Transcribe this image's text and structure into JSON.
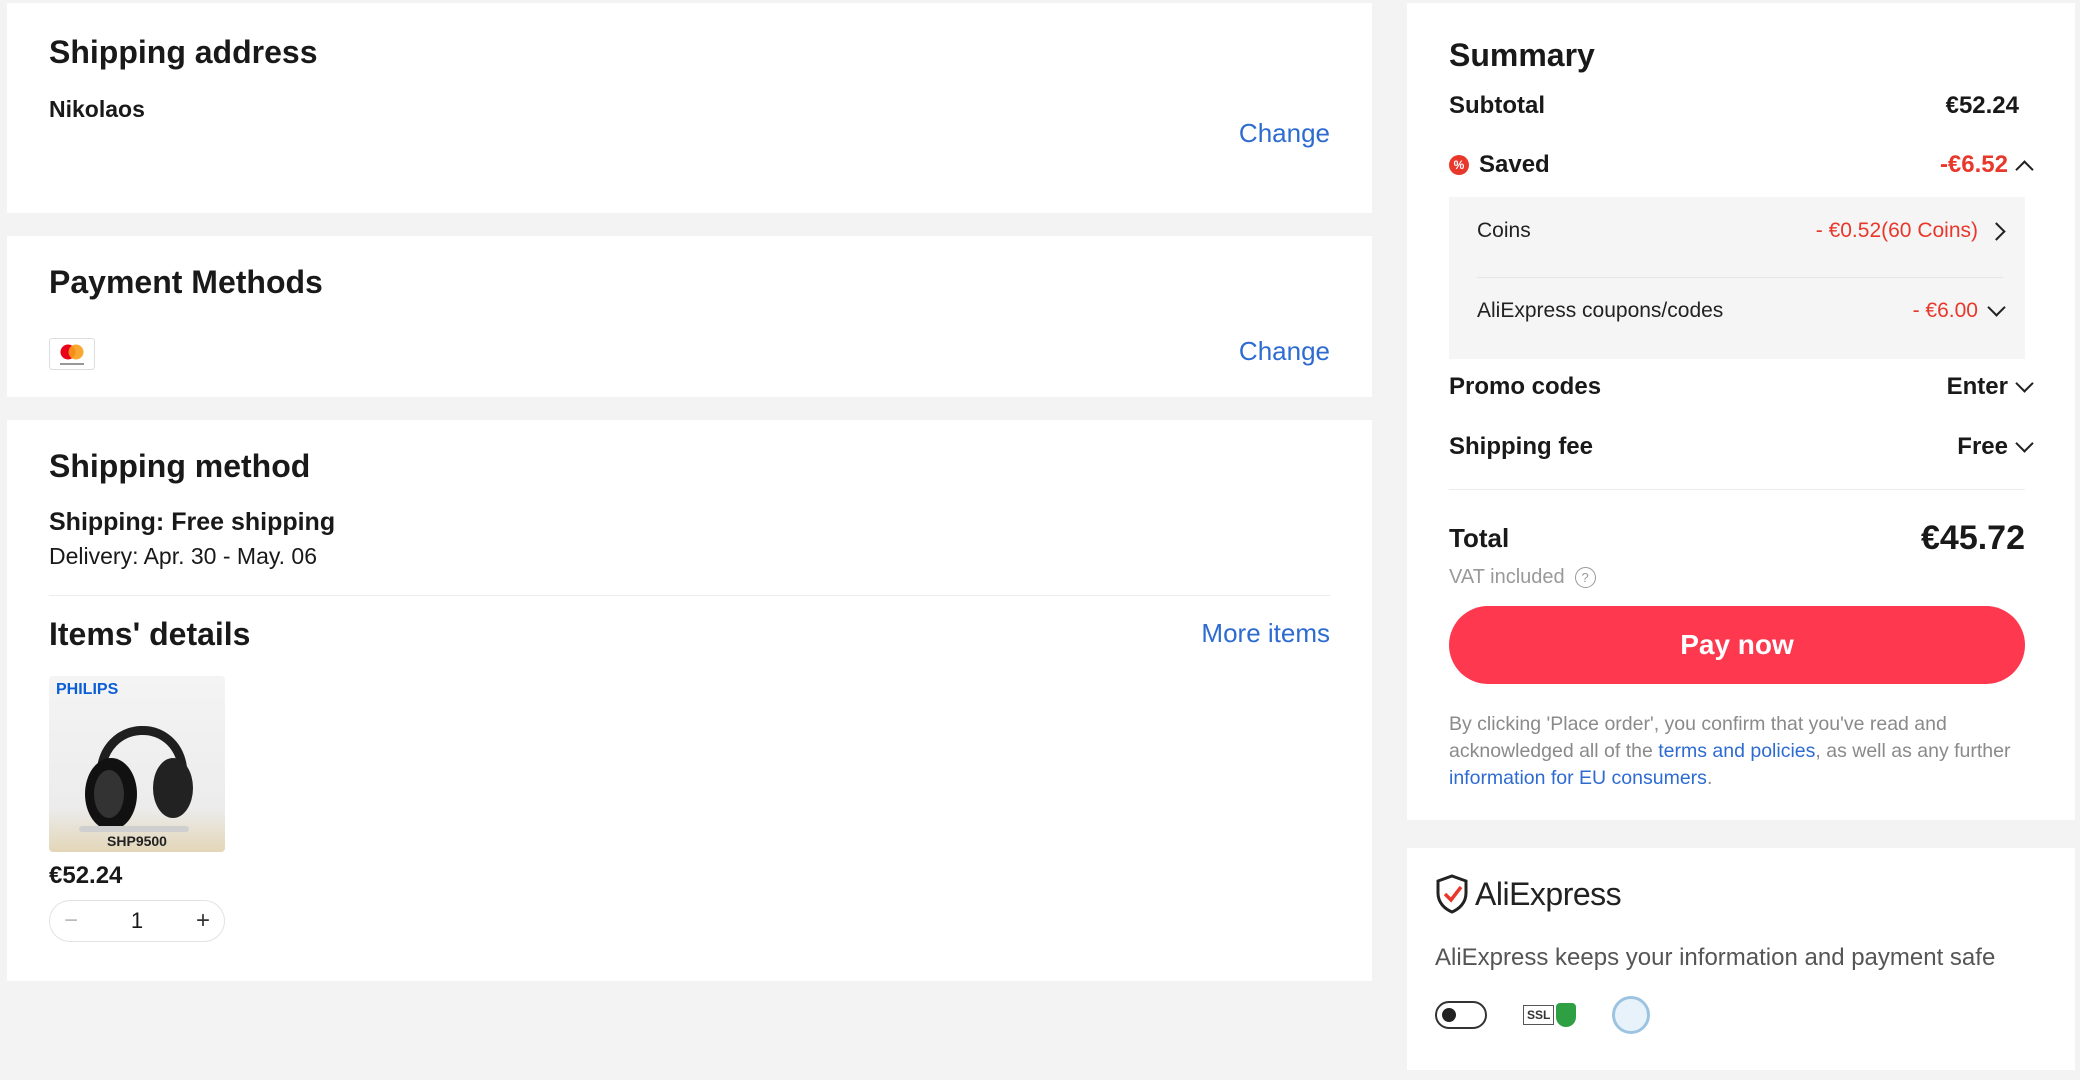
{
  "shipping_address": {
    "title": "Shipping address",
    "name": "Nikolaos",
    "change_label": "Change"
  },
  "payment": {
    "title": "Payment Methods",
    "card_icon": "mastercard-icon",
    "change_label": "Change"
  },
  "shipping_method": {
    "title": "Shipping method",
    "shipping": "Shipping: Free shipping",
    "delivery": "Delivery: Apr. 30 - May. 06"
  },
  "items": {
    "title": "Items' details",
    "more_label": "More items",
    "product": {
      "brand": "PHILIPS",
      "model": "SHP9500",
      "price": "€52.24",
      "quantity": "1"
    }
  },
  "summary": {
    "title": "Summary",
    "subtotal_label": "Subtotal",
    "subtotal_value": "€52.24",
    "saved_label": "Saved",
    "saved_value": "-€6.52",
    "coins_label": "Coins",
    "coins_value": "- €0.52(60 Coins)",
    "coupons_label": "AliExpress coupons/codes",
    "coupons_value": "- €6.00",
    "promo_label": "Promo codes",
    "promo_value": "Enter",
    "shipping_label": "Shipping fee",
    "shipping_value": "Free",
    "total_label": "Total",
    "total_value": "€45.72",
    "vat_label": "VAT included",
    "pay_label": "Pay now",
    "legal_1": "By clicking 'Place order', you confirm that you've read and acknowledged all of the ",
    "legal_link_1": "terms and policies",
    "legal_2": ", as well as any further ",
    "legal_link_2": "information for EU consumers",
    "legal_3": "."
  },
  "trust": {
    "brand": "AliExpress",
    "message": "AliExpress keeps your information and payment safe",
    "ssl_label": "SSL"
  },
  "colors": {
    "accent_red": "#fd384f",
    "link_blue": "#2e6bd1",
    "discount_red": "#e8382c"
  }
}
